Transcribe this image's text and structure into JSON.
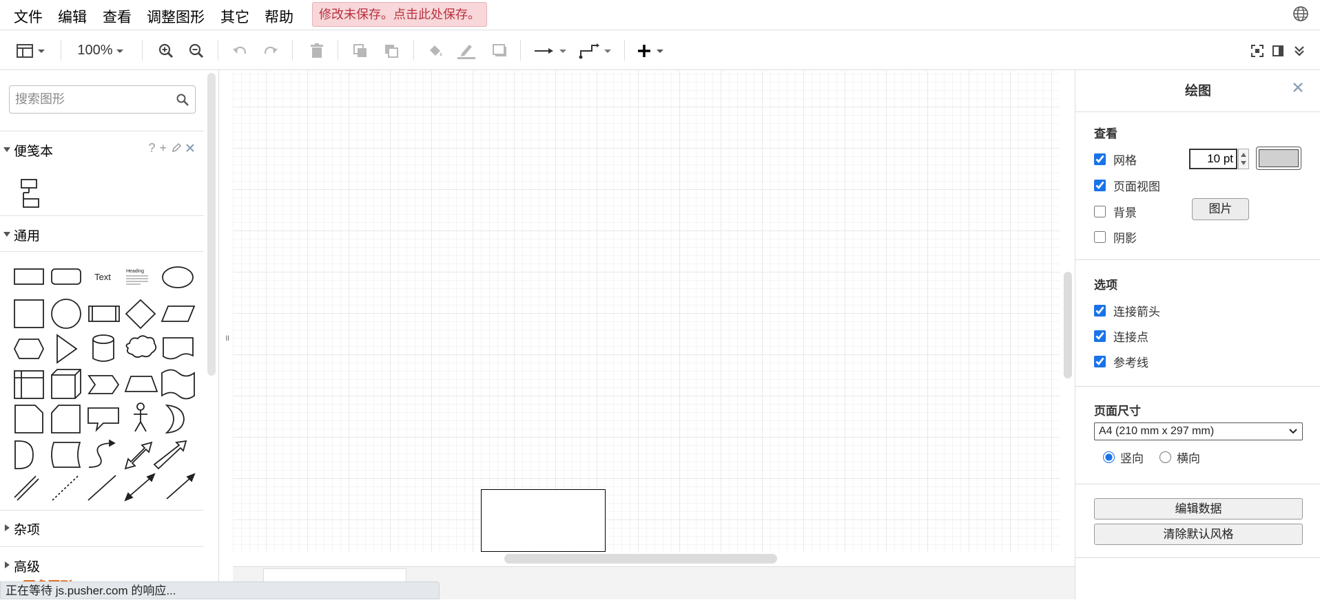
{
  "menu": {
    "file": "文件",
    "edit": "编辑",
    "view": "查看",
    "arrange": "调整图形",
    "extras": "其它",
    "help": "帮助",
    "unsaved_notice": "修改未保存。点击此处保存。"
  },
  "toolbar": {
    "zoom_level": "100%"
  },
  "sidebar": {
    "search_placeholder": "搜索图形",
    "scratchpad": {
      "label": "便笺本",
      "help": "?",
      "add": "+"
    },
    "general": {
      "label": "通用",
      "text_shape": "Text",
      "heading_shape": "Heading"
    },
    "misc": {
      "label": "杂项"
    },
    "advanced": {
      "label": "高级"
    },
    "more_shapes": "+ 更多图形"
  },
  "status": {
    "text": "正在等待 js.pusher.com 的响应..."
  },
  "right_panel": {
    "title": "绘图",
    "view_section": {
      "heading": "查看",
      "grid": {
        "label": "网格",
        "checked": true
      },
      "grid_size": "10 pt",
      "grid_color": "#d0d0d0",
      "page_view": {
        "label": "页面视图",
        "checked": true
      },
      "background": {
        "label": "背景",
        "checked": false
      },
      "image_button": "图片",
      "shadow": {
        "label": "阴影",
        "checked": false
      }
    },
    "options_section": {
      "heading": "选项",
      "connection_arrows": {
        "label": "连接箭头",
        "checked": true
      },
      "connection_points": {
        "label": "连接点",
        "checked": true
      },
      "guides": {
        "label": "参考线",
        "checked": true
      }
    },
    "page_size_section": {
      "heading": "页面尺寸",
      "selected": "A4 (210 mm x 297 mm)",
      "portrait": "竖向",
      "landscape": "横向",
      "orientation": "portrait"
    },
    "edit_data_button": "编辑数据",
    "clear_style_button": "清除默认风格"
  }
}
